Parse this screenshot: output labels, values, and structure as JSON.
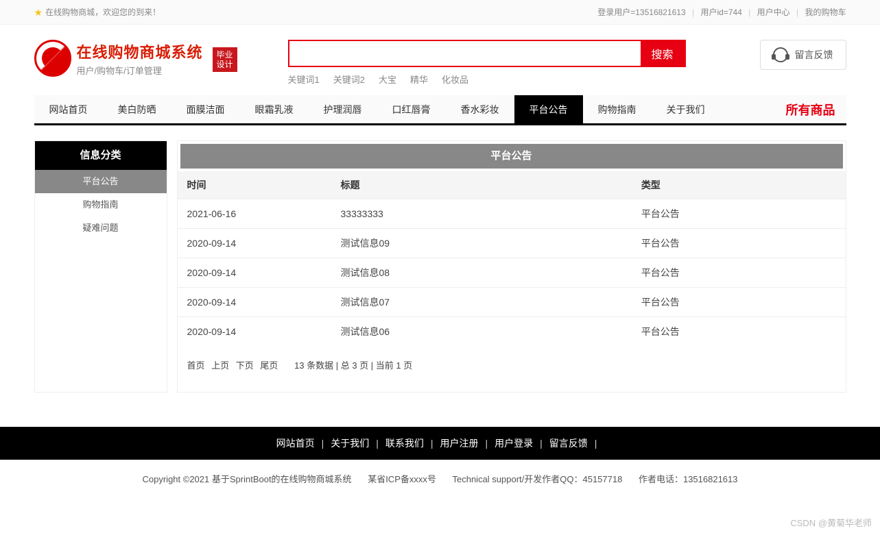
{
  "topbar": {
    "welcome": "在线购物商城，欢迎您的到来！",
    "user_label": "登录用户=13516821613",
    "uid_label": "用户id=744",
    "user_center": "用户中心",
    "my_cart": "我的购物车"
  },
  "logo": {
    "title": "在线购物商城系统",
    "subtitle": "用户/购物车/订单管理",
    "badge_line1": "毕业",
    "badge_line2": "设计"
  },
  "search": {
    "button": "搜索",
    "keywords": [
      "关键词1",
      "关键词2",
      "大宝",
      "精华",
      "化妆品"
    ]
  },
  "feedback": {
    "label": "留言反馈"
  },
  "nav": {
    "items": [
      "网站首页",
      "美白防晒",
      "面膜洁面",
      "眼霜乳液",
      "护理润唇",
      "口红唇膏",
      "香水彩妆",
      "平台公告",
      "购物指南",
      "关于我们"
    ],
    "active_index": 7,
    "all_products": "所有商品"
  },
  "sidebar": {
    "title": "信息分类",
    "items": [
      "平台公告",
      "购物指南",
      "疑难问题"
    ],
    "active_index": 0
  },
  "panel": {
    "title": "平台公告",
    "columns": {
      "time": "时间",
      "title": "标题",
      "type": "类型"
    },
    "rows": [
      {
        "time": "2021-06-16",
        "title": "33333333",
        "type": "平台公告"
      },
      {
        "time": "2020-09-14",
        "title": "测试信息09",
        "type": "平台公告"
      },
      {
        "time": "2020-09-14",
        "title": "测试信息08",
        "type": "平台公告"
      },
      {
        "time": "2020-09-14",
        "title": "测试信息07",
        "type": "平台公告"
      },
      {
        "time": "2020-09-14",
        "title": "测试信息06",
        "type": "平台公告"
      }
    ]
  },
  "pager": {
    "first": "首页",
    "prev": "上页",
    "next": "下页",
    "last": "尾页",
    "info": "13 条数据 | 总 3 页 | 当前 1 页"
  },
  "footer_nav": [
    "网站首页",
    "关于我们",
    "联系我们",
    "用户注册",
    "用户登录",
    "留言反馈"
  ],
  "footer_info": {
    "copyright": "Copyright ©2021 基于SprintBoot的在线购物商城系统",
    "icp": "某省ICP备xxxx号",
    "support": "Technical support/开发作者QQ：45157718",
    "phone": "作者电话：13516821613"
  },
  "watermark": "CSDN @黄菊华老师"
}
